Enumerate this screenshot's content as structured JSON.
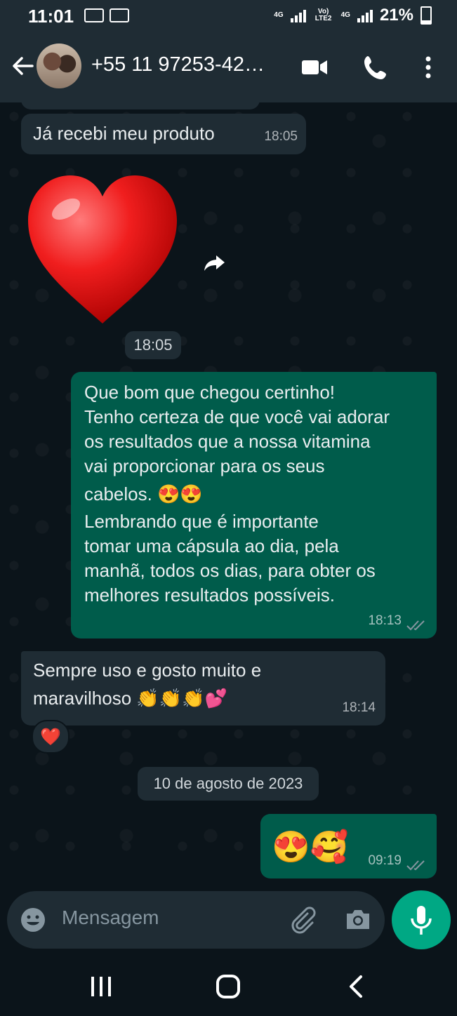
{
  "status_bar": {
    "time": "11:01",
    "network_1": "4G",
    "network_2": "Vo) LTE2",
    "network_3": "4G",
    "battery": "21%"
  },
  "header": {
    "contact_name": "+55 11 97253-42…",
    "icons": [
      "back-arrow-icon",
      "video-call-icon",
      "phone-icon",
      "more-options-icon"
    ]
  },
  "messages": [
    {
      "direction": "in",
      "text": "Já recebi  meu produto",
      "time": "18:05"
    },
    {
      "direction": "in",
      "sticker": "red-heart",
      "time": "18:05"
    },
    {
      "direction": "out",
      "lines": [
        "Que bom que chegou certinho!",
        "Tenho certeza de que você vai adorar",
        "os resultados que a nossa vitamina",
        "vai proporcionar para os seus",
        "cabelos. 😍😍",
        "Lembrando que é importante",
        "tomar uma cápsula ao dia, pela",
        "manhã, todos os dias, para obter os",
        "melhores resultados possíveis."
      ],
      "time": "18:13",
      "status": "read"
    },
    {
      "direction": "in",
      "lines": [
        "Sempre uso e gosto muito e",
        "maravilhoso 👏👏👏💕"
      ],
      "time": "18:14",
      "reaction": "❤️"
    },
    {
      "direction": "out",
      "text": "😍🥰",
      "time": "09:19",
      "status": "read"
    }
  ],
  "date_divider": "10 de agosto de 2023",
  "composer": {
    "placeholder": "Mensagem"
  },
  "colors": {
    "incoming": "#1f2c34",
    "outgoing": "#005c4b",
    "accent": "#00a884",
    "background": "#0b141a"
  }
}
